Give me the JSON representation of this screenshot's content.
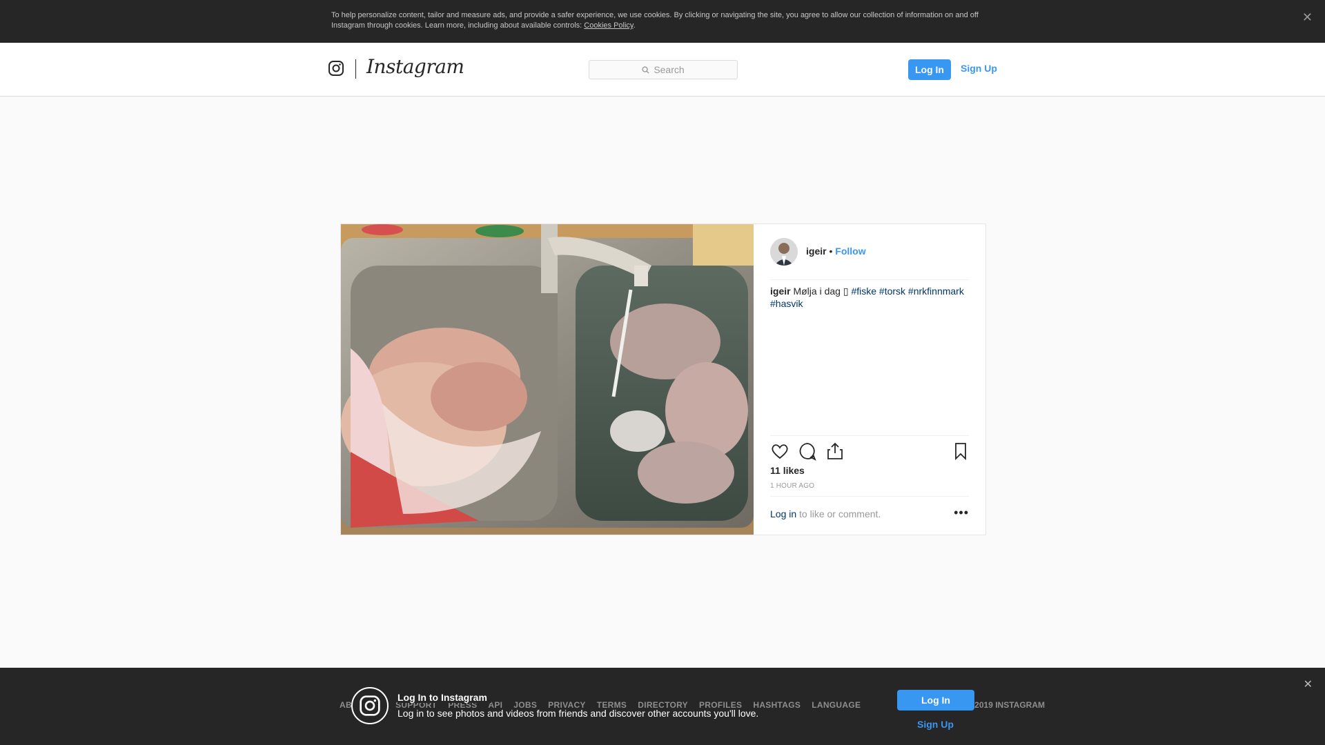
{
  "cookie_banner": {
    "text": "To help personalize content, tailor and measure ads, and provide a safer experience, we use cookies. By clicking or navigating the site, you agree to allow our collection of information on and off Instagram through cookies. Learn more, including about available controls: ",
    "policy_link": "Cookies Policy",
    "period": ".",
    "close_icon": "close-icon"
  },
  "header": {
    "logo_icon": "instagram-camera-icon",
    "wordmark": "Instagram",
    "search_placeholder": "Search",
    "search_icon": "search-icon",
    "login_label": "Log In",
    "signup_label": "Sign Up"
  },
  "post": {
    "photo_alt": "Photo of fish pieces and roe in a kitchen sink",
    "author": "igeir",
    "separator": " • ",
    "follow_label": "Follow",
    "caption_user": "igeir",
    "caption_text": " Mølja i dag ",
    "caption_emoji": "▯",
    "hashtags": [
      "#fiske",
      "#torsk",
      "#nrkfinnmark",
      "#hasvik"
    ],
    "actions": [
      "heart-icon",
      "comment-icon",
      "share-icon",
      "bookmark-icon"
    ],
    "likes": "11 likes",
    "time": "1 HOUR AGO",
    "comment_login_link": "Log in",
    "comment_text": " to like or comment.",
    "more_icon": "more-options-icon",
    "more_label": "•••"
  },
  "footer": {
    "links": [
      "ABOUT US",
      "SUPPORT",
      "PRESS",
      "API",
      "JOBS",
      "PRIVACY",
      "TERMS",
      "DIRECTORY",
      "PROFILES",
      "HASHTAGS",
      "LANGUAGE"
    ],
    "right_text": "© 2019 INSTAGRAM",
    "promo_title": "Log In to Instagram",
    "promo_subtitle": "Log in to see photos and videos from friends and discover other accounts you'll love.",
    "promo_login": "Log In",
    "promo_signup": "Sign Up",
    "close_icon": "close-icon"
  },
  "colors": {
    "accent": "#3897f0",
    "hashtag": "#003569",
    "dark_bar": "#262626"
  }
}
